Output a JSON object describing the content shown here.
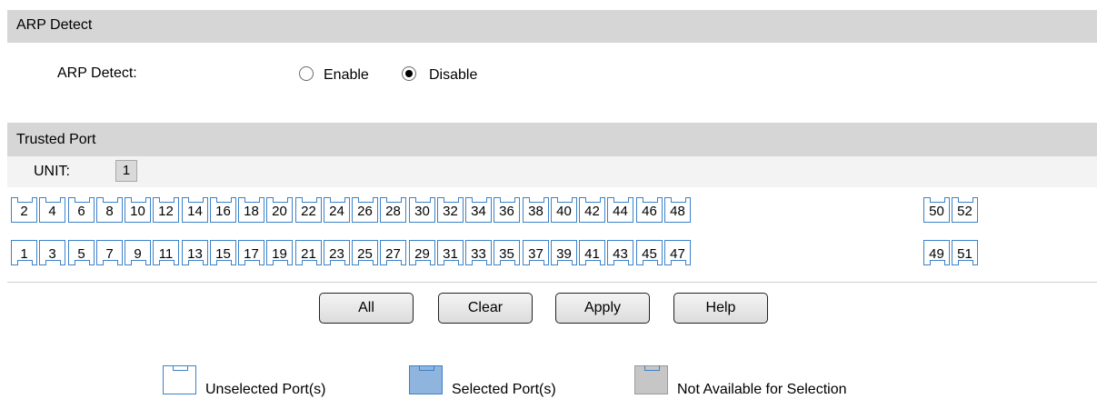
{
  "sections": {
    "arp_detect_title": "ARP Detect",
    "trusted_port_title": "Trusted Port"
  },
  "arp_detect": {
    "label": "ARP Detect:",
    "options": [
      "Enable",
      "Disable"
    ],
    "selected": "Disable"
  },
  "unit": {
    "label": "UNIT:",
    "value": "1"
  },
  "ports": {
    "top_row": [
      "2",
      "4",
      "6",
      "8",
      "10",
      "12",
      "14",
      "16",
      "18",
      "20",
      "22",
      "24",
      "26",
      "28",
      "30",
      "32",
      "34",
      "36",
      "38",
      "40",
      "42",
      "44",
      "46",
      "48",
      "50",
      "52"
    ],
    "bottom_row": [
      "1",
      "3",
      "5",
      "7",
      "9",
      "11",
      "13",
      "15",
      "17",
      "19",
      "21",
      "23",
      "25",
      "27",
      "29",
      "31",
      "33",
      "35",
      "37",
      "39",
      "41",
      "43",
      "45",
      "47",
      "49",
      "51"
    ],
    "selected": []
  },
  "buttons": {
    "all": "All",
    "clear": "Clear",
    "apply": "Apply",
    "help": "Help"
  },
  "legend": {
    "unselected": "Unselected Port(s)",
    "selected": "Selected Port(s)",
    "not_available": "Not Available for Selection"
  },
  "colors": {
    "port_border": "#3c82c8",
    "selected_fill": "#8fb4de",
    "unavailable_fill": "#c6c6c6",
    "header_bar": "#d6d6d6"
  }
}
